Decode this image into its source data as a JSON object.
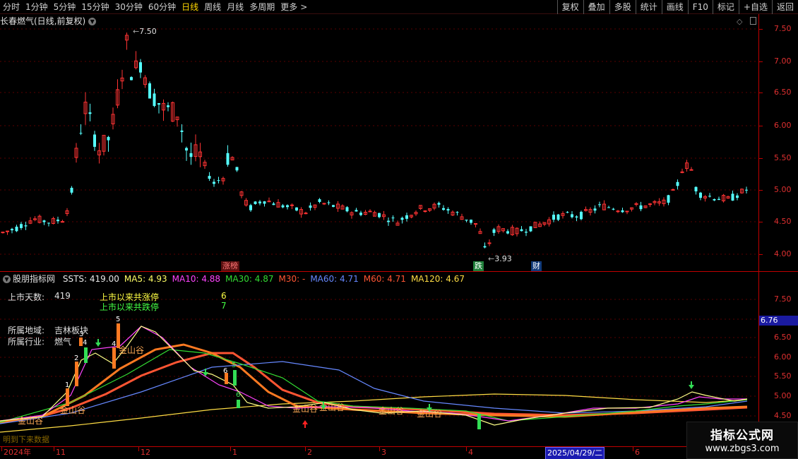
{
  "toolbar": {
    "periods": [
      "分时",
      "1分钟",
      "5分钟",
      "15分钟",
      "30分钟",
      "60分钟",
      "日线",
      "周线",
      "月线",
      "多周期",
      "更多"
    ],
    "active_period": "日线",
    "more_arrow": ">",
    "right_buttons": [
      "复权",
      "叠加",
      "多股",
      "统计",
      "画线",
      "F10",
      "标记",
      "+自选",
      "返回"
    ]
  },
  "main_pane": {
    "title": "长春燃气(日线,前复权)",
    "chevron_icon": "chevron-down-icon",
    "price_axis": [
      "7.50",
      "7.00",
      "6.50",
      "6.00",
      "5.50",
      "5.00",
      "4.50",
      "4.00"
    ],
    "high_label": "7.50",
    "low_label": "3.93",
    "markers": [
      {
        "text": "涨榜",
        "color": "#ff7777",
        "bg": "#5a1010"
      },
      {
        "text": "跌",
        "color": "#ffffff",
        "bg": "#1f7f3a"
      },
      {
        "text": "财",
        "color": "#ffffff",
        "bg": "#103a7a"
      }
    ]
  },
  "indicator_pane": {
    "name": "股朋指标网",
    "legend": [
      {
        "text": "SSTS: 419.00",
        "color": "#e8e8e8"
      },
      {
        "text": "MA5: 4.93",
        "color": "#ffff66"
      },
      {
        "text": "MA10: 4.88",
        "color": "#ff44ff"
      },
      {
        "text": "MA30: 4.87",
        "color": "#33dd33"
      },
      {
        "text": "M30: -",
        "color": "#ff5533"
      },
      {
        "text": "MA60: 4.71",
        "color": "#6688ff"
      },
      {
        "text": "M60: 4.71",
        "color": "#ff5533"
      },
      {
        "text": "MA120: 4.67",
        "color": "#ffdd44"
      }
    ],
    "listing_days_label": "上市天数:",
    "listing_days": "419",
    "limit_up_label": "上市以来共涨停",
    "limit_up_count": "6",
    "limit_down_label": "上市以来共跌停",
    "limit_down_count": "7",
    "region_label": "所属地域:",
    "region": "吉林板块",
    "industry_label": "所属行业:",
    "industry": "燃气",
    "price_axis": [
      "7.50",
      "7.00",
      "6.50",
      "6.00",
      "5.50",
      "5.00",
      "4.50"
    ],
    "current_value": "6.76",
    "jinshangu_label": "金山谷",
    "bottom_text": "明到下来数据",
    "bar_counts": [
      "1",
      "2",
      "3",
      "4",
      "4",
      "5",
      "6",
      "5",
      "6"
    ]
  },
  "date_axis": {
    "labels": [
      "2024年",
      "11",
      "12",
      "1",
      "2",
      "3",
      "4",
      "6"
    ],
    "cursor_date": "2025/04/29/二"
  },
  "watermark": {
    "title": "指标公式网",
    "url": "www.zbgs3.com"
  },
  "colors": {
    "up": "#ff3333",
    "down": "#55ffff",
    "grid": "#c00000"
  }
}
